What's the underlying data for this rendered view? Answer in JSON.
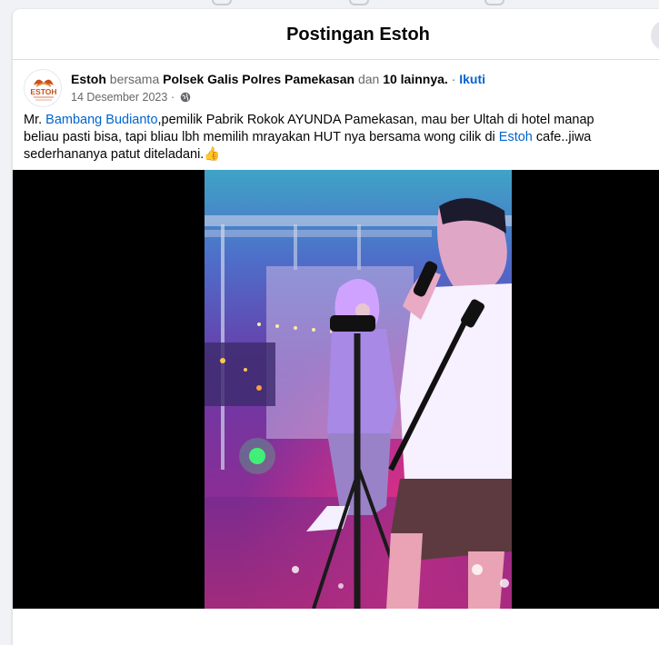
{
  "dialog": {
    "title": "Postingan Estoh"
  },
  "post": {
    "author": "Estoh",
    "with_word": "bersama",
    "tagged": "Polsek Galis Polres Pamekasan",
    "and_word": "dan",
    "others": "10 lainnya.",
    "separator": "·",
    "follow_label": "Ikuti",
    "date": "14 Desember 2023",
    "date_separator": "·",
    "text": {
      "prefix": "Mr.",
      "mention": "Bambang Budianto",
      "line1_rest": ",pemilik Pabrik Rokok AYUNDA Pamekasan, mau ber Ultah di hotel manap",
      "line2_start": "beliau pasti bisa, tapi bliau lbh memilih mrayakan HUT nya bersama wong cilik di",
      "mention2": "Estoh",
      "line2_end": "cafe..jiwa",
      "line3": "sederhananya patut diteladani.",
      "emoji": "👍"
    },
    "avatar_logo_text": "ESTOH"
  },
  "colors": {
    "link": "#0064d1",
    "secondary_text": "#65676b",
    "divider": "#dadde1"
  }
}
